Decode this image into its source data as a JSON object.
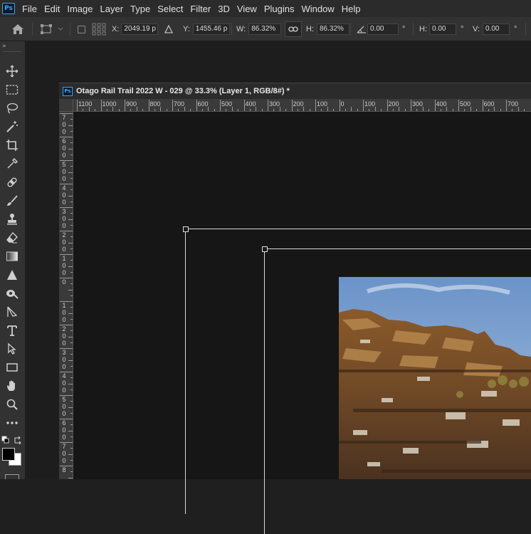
{
  "app": {
    "logo": "Ps"
  },
  "menu": [
    "File",
    "Edit",
    "Image",
    "Layer",
    "Type",
    "Select",
    "Filter",
    "3D",
    "View",
    "Plugins",
    "Window",
    "Help"
  ],
  "options": {
    "x_label": "X:",
    "x_value": "2049.19 p",
    "y_label": "Y:",
    "y_value": "1455.46 p",
    "w_label": "W:",
    "w_value": "86.32%",
    "h_label": "H:",
    "h_value": "86.32%",
    "rotate_value": "0.00",
    "rotate_unit": "°",
    "hskew_label": "H:",
    "hskew_value": "0.00",
    "hskew_unit": "°",
    "vskew_label": "V:",
    "vskew_value": "0.00",
    "vskew_unit": "°"
  },
  "document": {
    "title": "Otago Rail Trail 2022 W - 029 @ 33.3% (Layer 1, RGB/8#) *",
    "tab_logo": "Ps"
  },
  "ruler_top": [
    "1100",
    "1000",
    "900",
    "800",
    "700",
    "600",
    "500",
    "400",
    "300",
    "200",
    "100",
    "0",
    "100",
    "200",
    "300",
    "400",
    "500",
    "600",
    "700"
  ],
  "ruler_left": [
    "700",
    "600",
    "500",
    "400",
    "300",
    "200",
    "100",
    "0",
    "100",
    "200",
    "300",
    "400",
    "500",
    "600",
    "700",
    "8"
  ],
  "tools": [
    "move-tool",
    "marquee-tool",
    "lasso-tool",
    "magic-wand-tool",
    "crop-tool",
    "eyedropper-tool",
    "healing-brush-tool",
    "brush-tool",
    "clone-stamp-tool",
    "eraser-tool",
    "gradient-tool",
    "blur-tool",
    "dodge-tool",
    "pen-tool",
    "type-tool",
    "path-selection-tool",
    "rectangle-tool",
    "hand-tool",
    "zoom-tool",
    "more-tools"
  ],
  "colors": {
    "foreground": "#000000",
    "background": "#ffffff",
    "accent": "#31a8ff"
  }
}
